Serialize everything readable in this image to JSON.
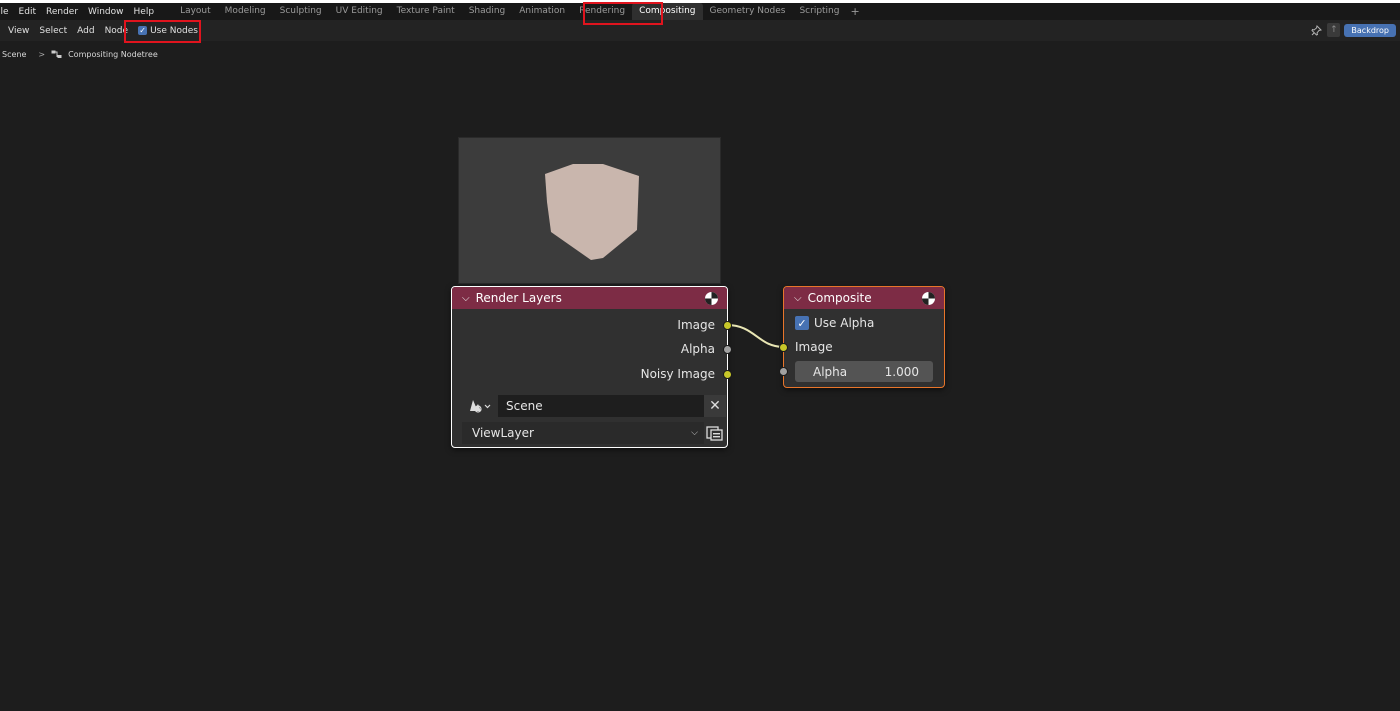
{
  "menu": {
    "items": [
      "File",
      "Edit",
      "Render",
      "Window",
      "Help"
    ],
    "first_label": "ile"
  },
  "workspace_tabs": [
    {
      "label": "Layout",
      "active": false
    },
    {
      "label": "Modeling",
      "active": false
    },
    {
      "label": "Sculpting",
      "active": false
    },
    {
      "label": "UV Editing",
      "active": false
    },
    {
      "label": "Texture Paint",
      "active": false
    },
    {
      "label": "Shading",
      "active": false
    },
    {
      "label": "Animation",
      "active": false
    },
    {
      "label": "Rendering",
      "active": false
    },
    {
      "label": "Compositing",
      "active": true
    },
    {
      "label": "Geometry Nodes",
      "active": false
    },
    {
      "label": "Scripting",
      "active": false
    }
  ],
  "tab_add": "+",
  "header": {
    "view": "View",
    "select": "Select",
    "add": "Add",
    "node": "Node",
    "use_nodes_label": "Use Nodes",
    "use_nodes_checked": true,
    "backdrop_label": "Backdrop"
  },
  "breadcrumb": {
    "scene": "Scene",
    "sep": ">",
    "nodetree": "Compositing Nodetree"
  },
  "render_layers_node": {
    "title": "Render Layers",
    "header_color": "#7d2c45",
    "outputs": [
      "Image",
      "Alpha",
      "Noisy Image"
    ],
    "scene_value": "Scene",
    "view_layer_value": "ViewLayer"
  },
  "composite_node": {
    "title": "Composite",
    "header_color": "#7d2c45",
    "use_alpha_label": "Use Alpha",
    "use_alpha_checked": true,
    "input_image": "Image",
    "alpha_label": "Alpha",
    "alpha_value": "1.000"
  },
  "colors": {
    "accent_blue": "#4772b3",
    "socket_yellow": "#c7c729",
    "socket_gray": "#a1a1a1",
    "highlight_red": "#e0141e",
    "cube_color": "#c9b6ad"
  },
  "icons": {
    "pin": "pin-icon",
    "parent": "parent-node-tree-icon",
    "nodetree": "node-tree-icon",
    "render": "render-result-icon",
    "scene": "scene-icon",
    "clear": "close-icon",
    "render_layer": "render-layer-icon"
  }
}
